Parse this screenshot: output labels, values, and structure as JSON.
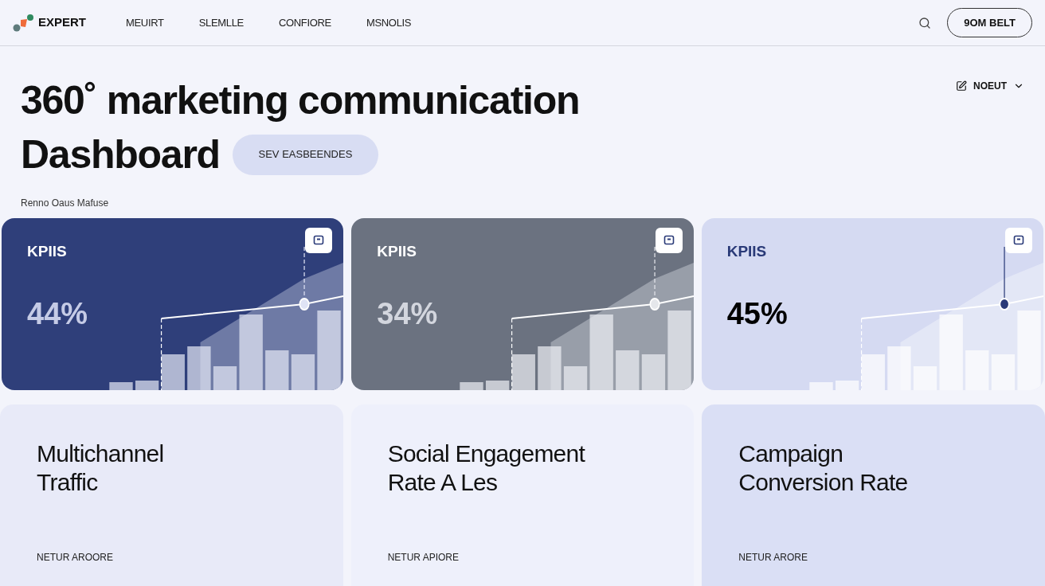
{
  "header": {
    "brand": "EXPERT",
    "nav": [
      {
        "label": "MEUIRT"
      },
      {
        "label": "SLEMLLE"
      },
      {
        "label": "CONFIORE"
      },
      {
        "label": "MSNOLIS"
      }
    ],
    "button": "9OM BЕLT"
  },
  "title_lines": [
    "360˚ marketing communication",
    "Dashboard"
  ],
  "pill_button": "SEV EASBEENDES",
  "view_menu": "NOEUT",
  "subtitle": "Renno Oaus Mafuse",
  "kpi_cards": [
    {
      "label": "KPIIS",
      "value": "44%"
    },
    {
      "label": "KPIIS",
      "value": "34%"
    },
    {
      "label": "KPIIS",
      "value": "45%"
    }
  ],
  "info_cards": [
    {
      "title_lines": [
        "Multichannel",
        "Traffic"
      ],
      "link": "NETUR AROORE"
    },
    {
      "title_lines": [
        "Social Engagement",
        "Rate A Les"
      ],
      "link": "NETUR APIORE"
    },
    {
      "title_lines": [
        "Campaign",
        "Conversion Rate"
      ],
      "link": "NETUR ARORE"
    }
  ]
}
